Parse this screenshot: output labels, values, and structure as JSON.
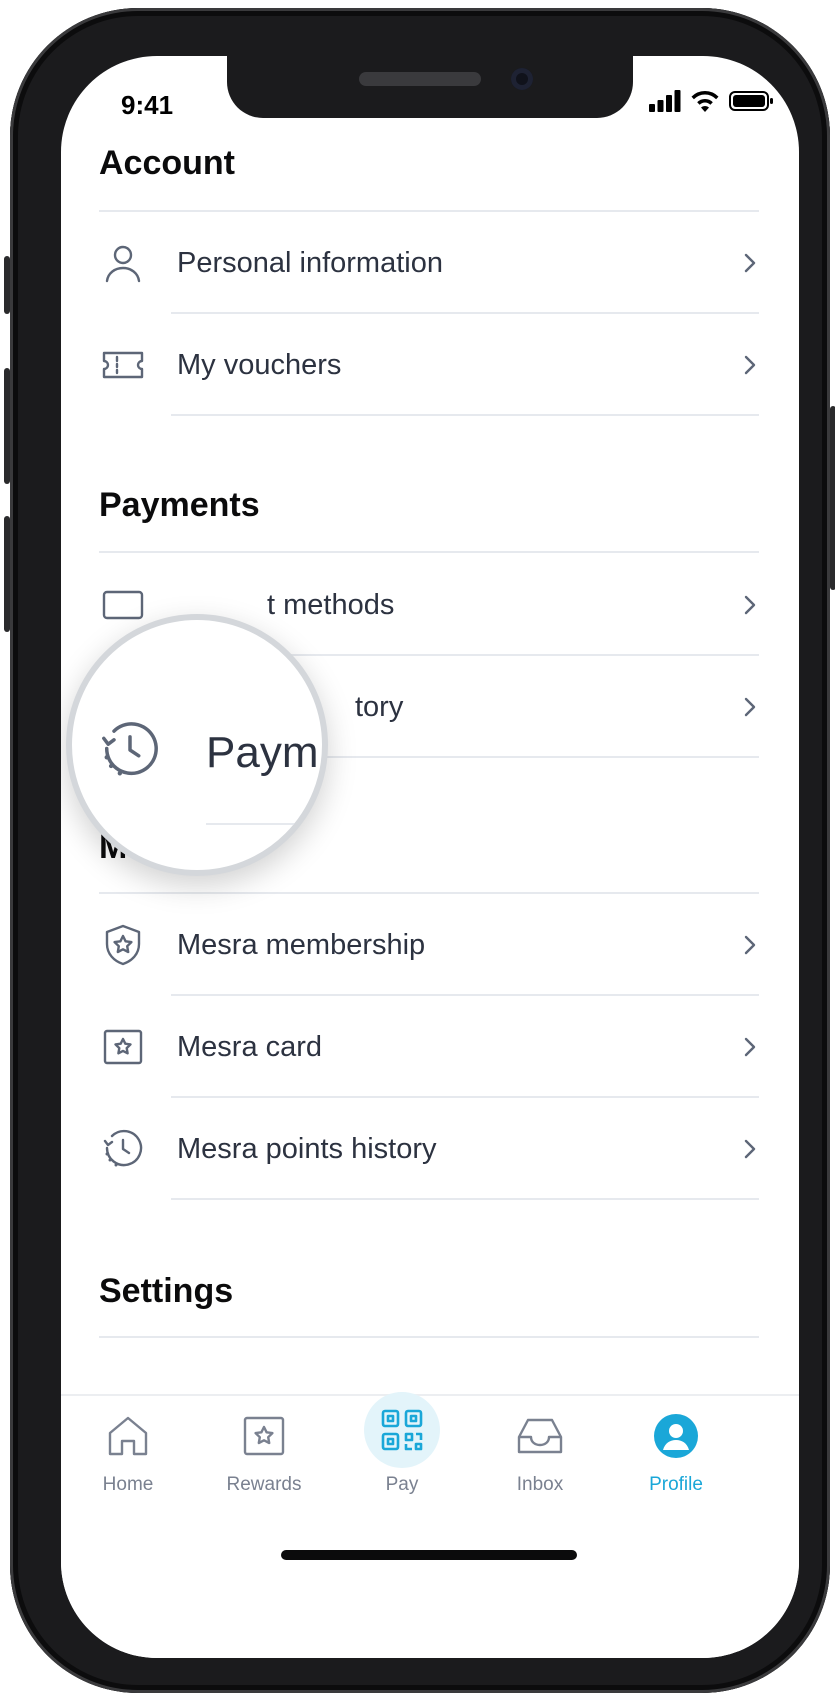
{
  "status": {
    "time": "9:41"
  },
  "sections": {
    "account": {
      "title": "Account",
      "items": [
        {
          "label": "Personal information",
          "icon": "person-icon"
        },
        {
          "label": "My vouchers",
          "icon": "ticket-icon"
        }
      ]
    },
    "payments": {
      "title": "Payments",
      "items": [
        {
          "label": "t methods",
          "icon": "card-icon"
        },
        {
          "label": "tory",
          "icon": "history-icon"
        }
      ]
    },
    "mesra": {
      "title": "Mesra",
      "items": [
        {
          "label": "Mesra membership",
          "icon": "shield-star-icon"
        },
        {
          "label": "Mesra card",
          "icon": "star-card-icon"
        },
        {
          "label": "Mesra points history",
          "icon": "history-icon"
        }
      ]
    },
    "settings": {
      "title": "Settings"
    }
  },
  "magnifier": {
    "label": "Paym"
  },
  "tabbar": {
    "tabs": [
      {
        "label": "Home",
        "icon": "home-icon"
      },
      {
        "label": "Rewards",
        "icon": "rewards-icon"
      },
      {
        "label": "Pay",
        "icon": "qr-icon"
      },
      {
        "label": "Inbox",
        "icon": "inbox-icon"
      },
      {
        "label": "Profile",
        "icon": "profile-icon"
      }
    ],
    "active": "Profile"
  },
  "colors": {
    "accent": "#1aa7d8",
    "text": "#2c3240",
    "heading": "#0b0b0c",
    "icon": "#5d6677",
    "divider": "#e6e9ee"
  }
}
